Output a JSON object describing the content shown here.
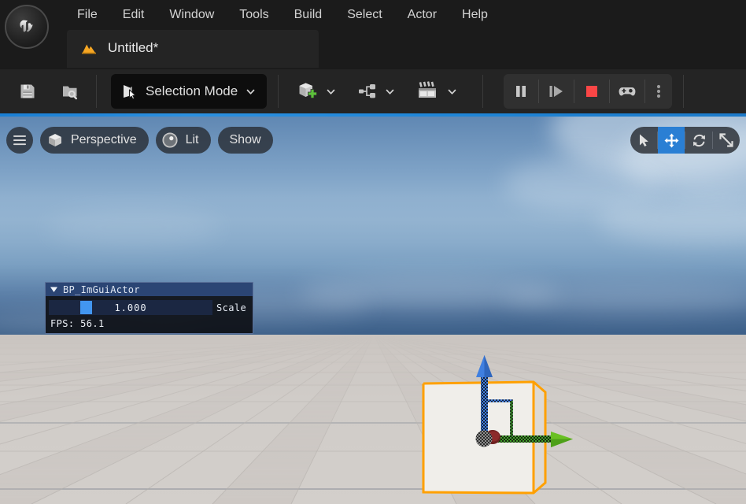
{
  "app": {
    "logo_icon": "unreal-engine-logo-icon"
  },
  "menu": {
    "items": [
      {
        "label": "File"
      },
      {
        "label": "Edit"
      },
      {
        "label": "Window"
      },
      {
        "label": "Tools"
      },
      {
        "label": "Build"
      },
      {
        "label": "Select"
      },
      {
        "label": "Actor"
      },
      {
        "label": "Help"
      }
    ]
  },
  "tab": {
    "icon": "level-mountain-icon",
    "label": "Untitled*"
  },
  "toolbar": {
    "save_icon": "save-floppy-icon",
    "browse_icon": "browse-content-icon",
    "mode": {
      "icon": "selection-cursor-icon",
      "label": "Selection Mode",
      "chevron": "chevron-down-icon"
    },
    "add_icon": "add-actor-cube-plus-icon",
    "add_chevron": "chevron-down-icon",
    "blueprints_icon": "blueprints-node-graph-icon",
    "blueprints_chevron": "chevron-down-icon",
    "cinematics_icon": "cinematics-clapperboard-icon",
    "cinematics_chevron": "chevron-down-icon",
    "play_controls": [
      {
        "name": "pause-button",
        "icon": "pause-icon"
      },
      {
        "name": "frame-step-button",
        "icon": "skip-play-icon"
      },
      {
        "name": "stop-button",
        "icon": "stop-square-icon"
      },
      {
        "name": "eject-possess-button",
        "icon": "gamepad-icon"
      },
      {
        "name": "play-options-button",
        "icon": "kebab-menu-icon"
      }
    ],
    "accent_red": "#fa4646",
    "accent_green": "#5cc03a"
  },
  "viewport": {
    "accent_color": "#1f86d8",
    "left_tools": [
      {
        "name": "viewport-menu-button",
        "icon": "hamburger-icon",
        "label": ""
      },
      {
        "name": "view-type-button",
        "icon": "cube-icon",
        "label": "Perspective"
      },
      {
        "name": "view-mode-button",
        "icon": "lit-sphere-icon",
        "label": "Lit"
      },
      {
        "name": "show-flags-button",
        "icon": "",
        "label": "Show"
      }
    ],
    "right_tools": [
      {
        "name": "select-tool",
        "icon": "arrow-cursor-icon",
        "active": false
      },
      {
        "name": "translate-tool",
        "icon": "move-arrows-icon",
        "active": true
      },
      {
        "name": "rotate-tool",
        "icon": "rotate-icon",
        "active": false
      },
      {
        "name": "scale-tool",
        "icon": "scale-expand-icon",
        "active": false
      }
    ],
    "selection_outline_color": "#ffa000",
    "gizmo": {
      "axis_z_color": "#3f7fe0",
      "axis_x_color": "#3f9c2a",
      "axis_y_color": "#8c2b2b"
    }
  },
  "imgui_panel": {
    "collapse_icon": "triangle-down-icon",
    "title": "BP_ImGuiActor",
    "slider": {
      "value": "1.000",
      "label": "Scale",
      "fill_color": "#4296f0",
      "track_color": "#1b2742"
    },
    "fps_text": "FPS: 56.1"
  }
}
